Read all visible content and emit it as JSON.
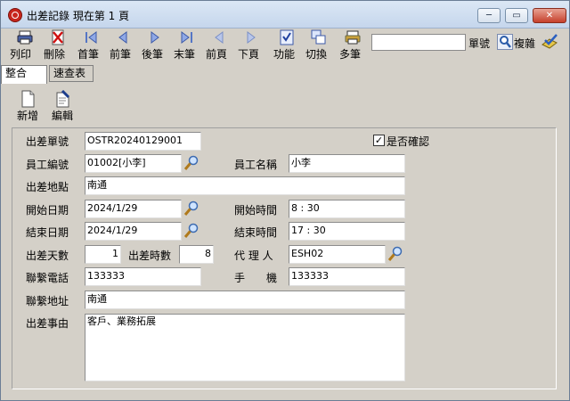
{
  "window": {
    "title": "出差記錄 現在第 1 頁",
    "minimize_label": "─",
    "maximize_label": "▭",
    "close_label": "✕"
  },
  "toolbar": {
    "print": "列印",
    "delete": "刪除",
    "first_record": "首筆",
    "prev_record": "前筆",
    "next_record": "後筆",
    "last_record": "末筆",
    "prev_page": "前頁",
    "next_page": "下頁",
    "function": "功能",
    "switch": "切換",
    "multi_record": "多筆",
    "search_value": "",
    "search_label": "單號",
    "copy_label": "複雜"
  },
  "tabs": {
    "integrate": "整合",
    "quick_lookup": "速查表"
  },
  "sub_toolbar": {
    "add": "新增",
    "edit": "編輯"
  },
  "form": {
    "trip_no_label": "出差單號",
    "trip_no": "OSTR20240129001",
    "confirmed_label": "是否確認",
    "confirmed": true,
    "emp_id_label": "員工編號",
    "emp_id": "01002[小李]",
    "emp_name_label": "員工名稱",
    "emp_name": "小李",
    "location_label": "出差地點",
    "location": "南通",
    "start_date_label": "開始日期",
    "start_date": "2024/1/29",
    "start_time_label": "開始時間",
    "start_time": " 8 : 30",
    "end_date_label": "結束日期",
    "end_date": "2024/1/29",
    "end_time_label": "結束時間",
    "end_time": "17 : 30",
    "days_label": "出差天數",
    "days": "1",
    "hours_label": "出差時數",
    "hours": "8",
    "agent_label": "代 理 人",
    "agent": "ESH02",
    "phone_label": "聯繫電話",
    "phone": "133333",
    "mobile_label": "手　　機",
    "mobile": "133333",
    "address_label": "聯繫地址",
    "address": "南通",
    "reason_label": "出差事由",
    "reason": "客戶、業務拓展"
  }
}
